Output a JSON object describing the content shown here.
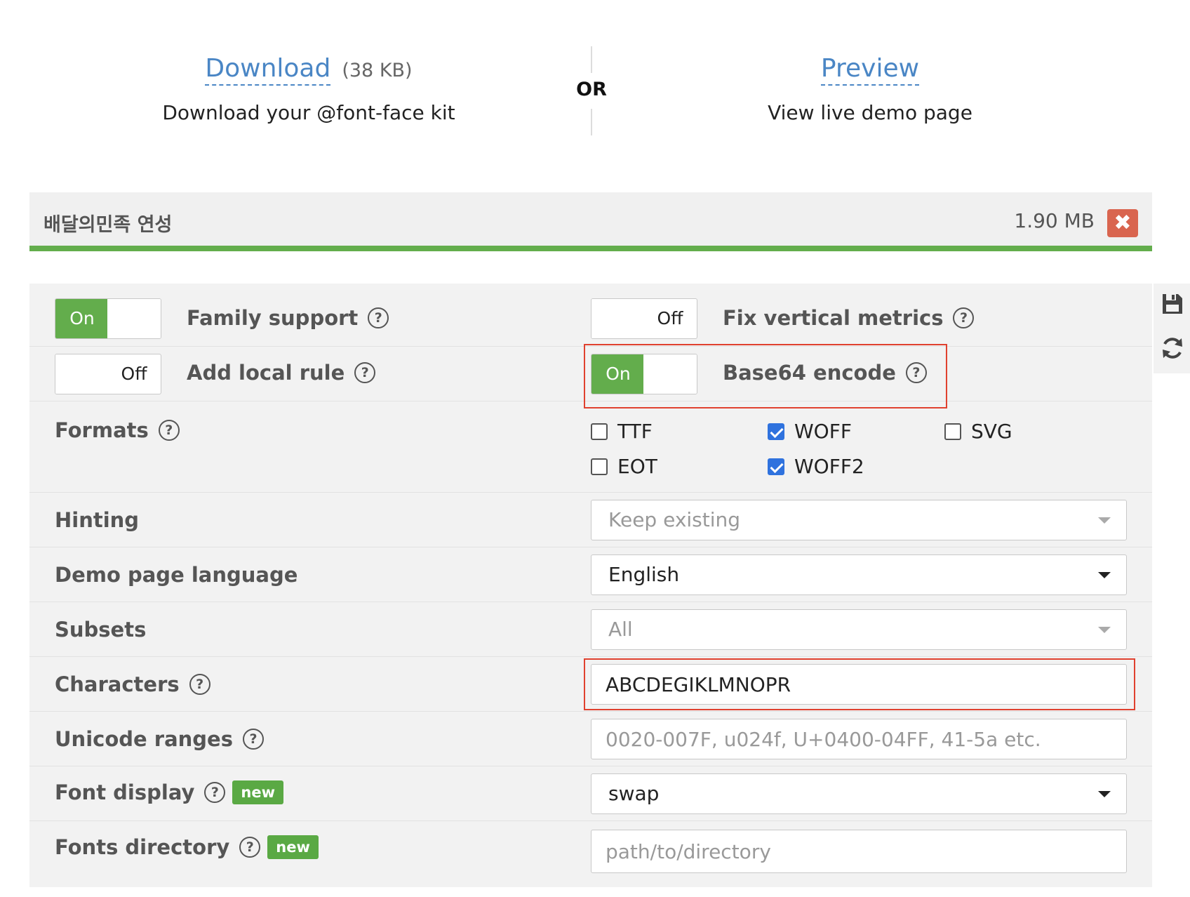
{
  "download": {
    "link": "Download",
    "size": "(38 KB)",
    "subtitle": "Download your @font-face kit"
  },
  "or_label": "OR",
  "preview": {
    "link": "Preview",
    "subtitle": "View live demo page"
  },
  "font": {
    "name": "배달의민족 연성",
    "size": "1.90 MB",
    "remove_icon": "close-icon"
  },
  "toggles": {
    "family_support": {
      "label": "Family support",
      "state": "On"
    },
    "add_local_rule": {
      "label": "Add local rule",
      "state": "Off"
    },
    "fix_vertical_metrics": {
      "label": "Fix vertical metrics",
      "state": "Off"
    },
    "base64_encode": {
      "label": "Base64 encode",
      "state": "On"
    }
  },
  "toggle_text": {
    "on": "On",
    "off": "Off"
  },
  "formats": {
    "label": "Formats",
    "options": [
      {
        "name": "TTF",
        "checked": false
      },
      {
        "name": "WOFF",
        "checked": true
      },
      {
        "name": "SVG",
        "checked": false
      },
      {
        "name": "EOT",
        "checked": false
      },
      {
        "name": "WOFF2",
        "checked": true
      }
    ]
  },
  "hinting": {
    "label": "Hinting",
    "value": "Keep existing",
    "disabled": true
  },
  "demo_language": {
    "label": "Demo page language",
    "value": "English"
  },
  "subsets": {
    "label": "Subsets",
    "value": "All",
    "disabled": true
  },
  "characters": {
    "label": "Characters",
    "value": "ABCDEGIKLMNOPR"
  },
  "unicode_ranges": {
    "label": "Unicode ranges",
    "placeholder": "0020-007F, u024f, U+0400-04FF, 41-5a etc."
  },
  "font_display": {
    "label": "Font display",
    "badge": "new",
    "value": "swap"
  },
  "fonts_directory": {
    "label": "Fonts directory",
    "badge": "new",
    "placeholder": "path/to/directory"
  },
  "help_symbol": "?",
  "side_icons": [
    "save-icon",
    "refresh-icon"
  ],
  "colors": {
    "accent_green": "#63ad4c",
    "link_blue": "#4a86c5",
    "remove_red": "#d9654f",
    "highlight_red": "#e0412f",
    "checkbox_blue": "#2f72de"
  }
}
